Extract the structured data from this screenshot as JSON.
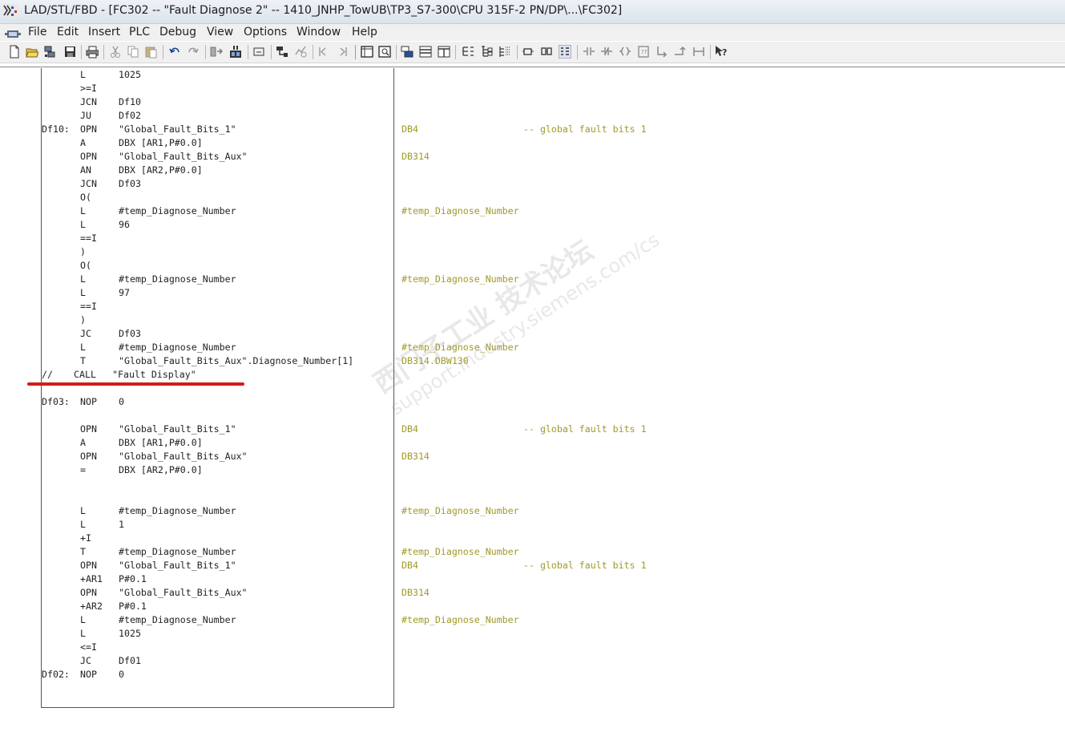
{
  "window": {
    "title": "LAD/STL/FBD  - [FC302 -- \"Fault Diagnose 2\" -- 1410_JNHP_TowUB\\TP3_S7-300\\CPU 315F-2 PN/DP\\...\\FC302]"
  },
  "menu": [
    "File",
    "Edit",
    "Insert",
    "PLC",
    "Debug",
    "View",
    "Options",
    "Window",
    "Help"
  ],
  "toolbar": {
    "icons": [
      "new-icon",
      "open-icon",
      "accessible-nodes-icon",
      "save-icon",
      "print-icon",
      "cut-icon",
      "copy-icon",
      "paste-icon",
      "undo-icon",
      "redo-icon",
      "download-icon",
      "online-monitor-icon",
      "insert-network-icon",
      "go-to-icon",
      "breakpoint-icon",
      "previous-network-icon",
      "next-network-icon",
      "overview-icon",
      "details-icon",
      "symbol-info-icon",
      "list-view-icon",
      "columns-view-icon",
      "network-tree-icon",
      "multi-instance-icon",
      "data-block-icon",
      "display-symbol-icon",
      "comment-icon",
      "contact-no-icon",
      "contact-nc-icon",
      "coil-icon",
      "empty-box-icon",
      "open-branch-icon",
      "close-branch-icon",
      "connection-icon",
      "help-icon"
    ]
  },
  "code": {
    "lines": [
      {
        "label": "",
        "op": "L",
        "arg": "1025",
        "sym": "",
        "cmt": ""
      },
      {
        "label": "",
        "op": ">=I",
        "arg": "",
        "sym": "",
        "cmt": ""
      },
      {
        "label": "",
        "op": "JCN",
        "arg": "Df10",
        "sym": "",
        "cmt": ""
      },
      {
        "label": "",
        "op": "JU",
        "arg": "Df02",
        "sym": "",
        "cmt": ""
      },
      {
        "label": "Df10:",
        "op": "OPN",
        "arg": "\"Global_Fault_Bits_1\"",
        "sym": "DB4",
        "cmt": "-- global fault bits 1"
      },
      {
        "label": "",
        "op": "A",
        "arg": "DBX [AR1,P#0.0]",
        "sym": "",
        "cmt": ""
      },
      {
        "label": "",
        "op": "OPN",
        "arg": "\"Global_Fault_Bits_Aux\"",
        "sym": "DB314",
        "cmt": ""
      },
      {
        "label": "",
        "op": "AN",
        "arg": "DBX [AR2,P#0.0]",
        "sym": "",
        "cmt": ""
      },
      {
        "label": "",
        "op": "JCN",
        "arg": "Df03",
        "sym": "",
        "cmt": ""
      },
      {
        "label": "",
        "op": "O(",
        "arg": "",
        "sym": "",
        "cmt": ""
      },
      {
        "label": "",
        "op": "L",
        "arg": "#temp_Diagnose_Number",
        "sym": "#temp_Diagnose_Number",
        "cmt": ""
      },
      {
        "label": "",
        "op": "L",
        "arg": "96",
        "sym": "",
        "cmt": ""
      },
      {
        "label": "",
        "op": "==I",
        "arg": "",
        "sym": "",
        "cmt": ""
      },
      {
        "label": "",
        "op": ")",
        "arg": "",
        "sym": "",
        "cmt": ""
      },
      {
        "label": "",
        "op": "O(",
        "arg": "",
        "sym": "",
        "cmt": ""
      },
      {
        "label": "",
        "op": "L",
        "arg": "#temp_Diagnose_Number",
        "sym": "#temp_Diagnose_Number",
        "cmt": ""
      },
      {
        "label": "",
        "op": "L",
        "arg": "97",
        "sym": "",
        "cmt": ""
      },
      {
        "label": "",
        "op": "==I",
        "arg": "",
        "sym": "",
        "cmt": ""
      },
      {
        "label": "",
        "op": ")",
        "arg": "",
        "sym": "",
        "cmt": ""
      },
      {
        "label": "",
        "op": "JC",
        "arg": "Df03",
        "sym": "",
        "cmt": ""
      },
      {
        "label": "",
        "op": "L",
        "arg": "#temp_Diagnose_Number",
        "sym": "#temp_Diagnose_Number",
        "cmt": ""
      },
      {
        "label": "",
        "op": "T",
        "arg": "\"Global_Fault_Bits_Aux\".Diagnose_Number[1]",
        "sym": "DB314.DBW130",
        "cmt": ""
      },
      {
        "label": "//",
        "op": "CALL",
        "arg": "\"Fault Display\"",
        "sym": "",
        "cmt": "",
        "commented": true
      },
      {
        "label": "",
        "op": "",
        "arg": "",
        "sym": "",
        "cmt": ""
      },
      {
        "label": "Df03:",
        "op": "NOP",
        "arg": "0",
        "sym": "",
        "cmt": ""
      },
      {
        "label": "",
        "op": "",
        "arg": "",
        "sym": "",
        "cmt": ""
      },
      {
        "label": "",
        "op": "OPN",
        "arg": "\"Global_Fault_Bits_1\"",
        "sym": "DB4",
        "cmt": "-- global fault bits 1"
      },
      {
        "label": "",
        "op": "A",
        "arg": "DBX [AR1,P#0.0]",
        "sym": "",
        "cmt": ""
      },
      {
        "label": "",
        "op": "OPN",
        "arg": "\"Global_Fault_Bits_Aux\"",
        "sym": "DB314",
        "cmt": ""
      },
      {
        "label": "",
        "op": "=",
        "arg": "DBX [AR2,P#0.0]",
        "sym": "",
        "cmt": ""
      },
      {
        "label": "",
        "op": "",
        "arg": "",
        "sym": "",
        "cmt": ""
      },
      {
        "label": "",
        "op": "",
        "arg": "",
        "sym": "",
        "cmt": ""
      },
      {
        "label": "",
        "op": "L",
        "arg": "#temp_Diagnose_Number",
        "sym": "#temp_Diagnose_Number",
        "cmt": ""
      },
      {
        "label": "",
        "op": "L",
        "arg": "1",
        "sym": "",
        "cmt": ""
      },
      {
        "label": "",
        "op": "+I",
        "arg": "",
        "sym": "",
        "cmt": ""
      },
      {
        "label": "",
        "op": "T",
        "arg": "#temp_Diagnose_Number",
        "sym": "#temp_Diagnose_Number",
        "cmt": ""
      },
      {
        "label": "",
        "op": "OPN",
        "arg": "\"Global_Fault_Bits_1\"",
        "sym": "DB4",
        "cmt": "-- global fault bits 1"
      },
      {
        "label": "",
        "op": "+AR1",
        "arg": "P#0.1",
        "sym": "",
        "cmt": ""
      },
      {
        "label": "",
        "op": "OPN",
        "arg": "\"Global_Fault_Bits_Aux\"",
        "sym": "DB314",
        "cmt": ""
      },
      {
        "label": "",
        "op": "+AR2",
        "arg": "P#0.1",
        "sym": "",
        "cmt": ""
      },
      {
        "label": "",
        "op": "L",
        "arg": "#temp_Diagnose_Number",
        "sym": "#temp_Diagnose_Number",
        "cmt": ""
      },
      {
        "label": "",
        "op": "L",
        "arg": "1025",
        "sym": "",
        "cmt": ""
      },
      {
        "label": "",
        "op": "<=I",
        "arg": "",
        "sym": "",
        "cmt": ""
      },
      {
        "label": "",
        "op": "JC",
        "arg": "Df01",
        "sym": "",
        "cmt": ""
      },
      {
        "label": "Df02:",
        "op": "NOP",
        "arg": "0",
        "sym": "",
        "cmt": ""
      }
    ]
  },
  "watermark": {
    "line1": "西门子工业 技术论坛",
    "line2": "support.industry.siemens.com/cs"
  },
  "colors": {
    "symbol": "#a09a28",
    "annotation_line": "#d41a1a"
  }
}
